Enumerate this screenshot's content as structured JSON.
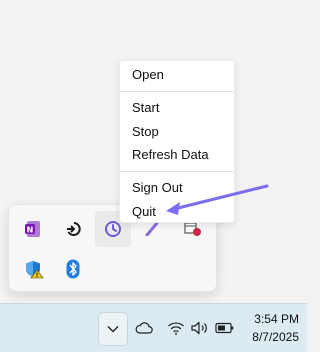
{
  "context_menu": {
    "items": [
      {
        "label": "Open"
      },
      {
        "label": "Start"
      },
      {
        "label": "Stop"
      },
      {
        "label": "Refresh Data"
      },
      {
        "label": "Sign Out"
      },
      {
        "label": "Quit"
      }
    ]
  },
  "tray_flyout": {
    "icons": [
      {
        "name": "onenote-icon",
        "color": "#7719aa"
      },
      {
        "name": "sync-arrow-icon",
        "color": "#1a1a1a"
      },
      {
        "name": "timer-app-icon",
        "color": "#6b5cd6"
      },
      {
        "name": "feather-icon",
        "color": "#8a6ddc"
      },
      {
        "name": "folder-alert-icon",
        "color": "#d0244a"
      },
      {
        "name": "security-shield-warning-icon",
        "color": "#1b78d0"
      },
      {
        "name": "bluetooth-icon",
        "color": "#1f7fe0"
      }
    ]
  },
  "taskbar": {
    "overflow_icon": "chevron-down-icon",
    "system_icons": [
      "cloud-icon",
      "wifi-icon",
      "speaker-icon",
      "battery-icon"
    ],
    "clock": {
      "time": "3:54 PM",
      "date": "8/7/2025"
    }
  },
  "colors": {
    "annotation_arrow": "#7b6ef0",
    "taskbar_bg": "#dceaf2"
  }
}
